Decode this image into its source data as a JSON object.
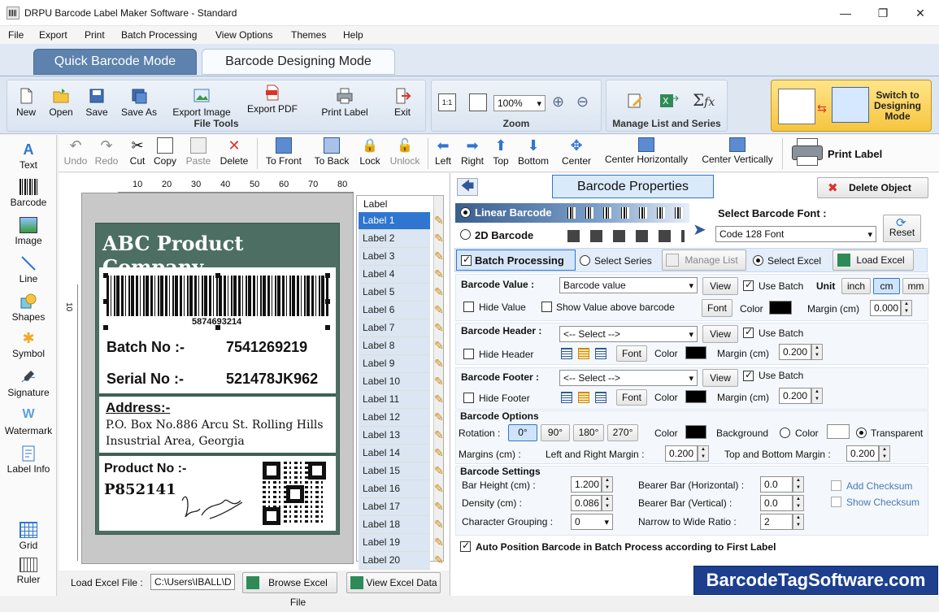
{
  "window": {
    "title": "DRPU Barcode Label Maker Software - Standard"
  },
  "menu": [
    "File",
    "Export",
    "Print",
    "Batch Processing",
    "View Options",
    "Themes",
    "Help"
  ],
  "modes": {
    "quick": "Quick Barcode Mode",
    "design": "Barcode Designing Mode"
  },
  "ribbon": {
    "file_tools": {
      "label": "File Tools",
      "buttons": [
        "New",
        "Open",
        "Save",
        "Save As",
        "Export Image",
        "Export PDF",
        "Print Label",
        "Exit"
      ]
    },
    "zoom": {
      "label": "Zoom",
      "value": "100%"
    },
    "manage": {
      "label": "Manage List and Series"
    },
    "switch": {
      "label": "Switch to Designing Mode"
    }
  },
  "edit_toolbar": {
    "buttons": [
      "Undo",
      "Redo",
      "Cut",
      "Copy",
      "Paste",
      "Delete",
      "To Front",
      "To Back",
      "Lock",
      "Unlock",
      "Left",
      "Right",
      "Top",
      "Bottom",
      "Center",
      "Center Horizontally",
      "Center Vertically"
    ],
    "print_label": "Print Label"
  },
  "left_tools": [
    "Text",
    "Barcode",
    "Image",
    "Line",
    "Shapes",
    "Symbol",
    "Signature",
    "Watermark",
    "Label Info",
    "Grid",
    "Ruler"
  ],
  "ruler": {
    "h_ticks": [
      "10",
      "20",
      "30",
      "40",
      "50",
      "60",
      "70",
      "80"
    ],
    "v_ticks": [
      "10"
    ]
  },
  "label": {
    "company": "ABC Product Company",
    "barcode_number": "5874693214",
    "batch_label": "Batch No :-",
    "batch_value": "7541269219",
    "serial_label": "Serial No :-",
    "serial_value": "521478JK962",
    "address_label": "Address:-",
    "address_line1": "P.O. Box No.886 Arcu St. Rolling Hills",
    "address_line2": "Insustrial Area, Georgia",
    "product_label": "Product No :-",
    "product_value": "P852141"
  },
  "label_list": {
    "header": "Label",
    "items": [
      "Label 1",
      "Label 2",
      "Label 3",
      "Label 4",
      "Label 5",
      "Label 6",
      "Label 7",
      "Label 8",
      "Label 9",
      "Label 10",
      "Label 11",
      "Label 12",
      "Label 13",
      "Label 14",
      "Label 15",
      "Label 16",
      "Label 17",
      "Label 18",
      "Label 19",
      "Label 20"
    ]
  },
  "bottom": {
    "load_excel_label": "Load Excel File :",
    "path": "C:\\Users\\IBALL\\D",
    "browse": "Browse Excel File",
    "view": "View Excel Data"
  },
  "props": {
    "title": "Barcode Properties",
    "delete": "Delete Object",
    "linear": "Linear Barcode",
    "twod": "2D Barcode",
    "select_font_label": "Select Barcode Font :",
    "font": "Code 128 Font",
    "reset": "Reset",
    "batch_processing": "Batch Processing",
    "select_series": "Select Series",
    "manage_list": "Manage List",
    "select_excel": "Select Excel",
    "load_excel": "Load Excel",
    "barcode_value_label": "Barcode Value :",
    "barcode_value": "Barcode value",
    "view": "View",
    "use_batch": "Use Batch",
    "unit": "Unit",
    "units": [
      "inch",
      "cm",
      "mm"
    ],
    "hide_value": "Hide Value",
    "show_above": "Show Value above barcode",
    "font_btn": "Font",
    "color": "Color",
    "margin_cm": "Margin (cm)",
    "margin_value": "0.000",
    "header_label": "Barcode Header :",
    "select_placeholder": "<-- Select -->",
    "hide_header": "Hide Header",
    "header_margin": "0.200",
    "footer_label": "Barcode Footer :",
    "hide_footer": "Hide Footer",
    "footer_margin": "0.200",
    "options_title": "Barcode Options",
    "rotation": "Rotation :",
    "rotations": [
      "0°",
      "90°",
      "180°",
      "270°"
    ],
    "background": "Background",
    "transparent": "Transparent",
    "margins_cm": "Margins (cm) :",
    "lr_margin": "Left and Right Margin :",
    "lr_value": "0.200",
    "tb_margin": "Top and Bottom Margin :",
    "tb_value": "0.200",
    "settings_title": "Barcode Settings",
    "bar_height": "Bar Height (cm) :",
    "bar_height_value": "1.200",
    "density": "Density (cm) :",
    "density_value": "0.086",
    "char_grouping": "Character Grouping :",
    "char_grouping_value": "0",
    "bearer_h": "Bearer Bar (Horizontal) :",
    "bearer_h_value": "0.0",
    "bearer_v": "Bearer Bar (Vertical) :",
    "bearer_v_value": "0.0",
    "narrow_wide": "Narrow to Wide Ratio :",
    "narrow_wide_value": "2",
    "add_checksum": "Add Checksum",
    "show_checksum": "Show Checksum",
    "auto_position": "Auto Position Barcode in Batch Process according to First Label"
  },
  "brand": "BarcodeTagSoftware.com"
}
